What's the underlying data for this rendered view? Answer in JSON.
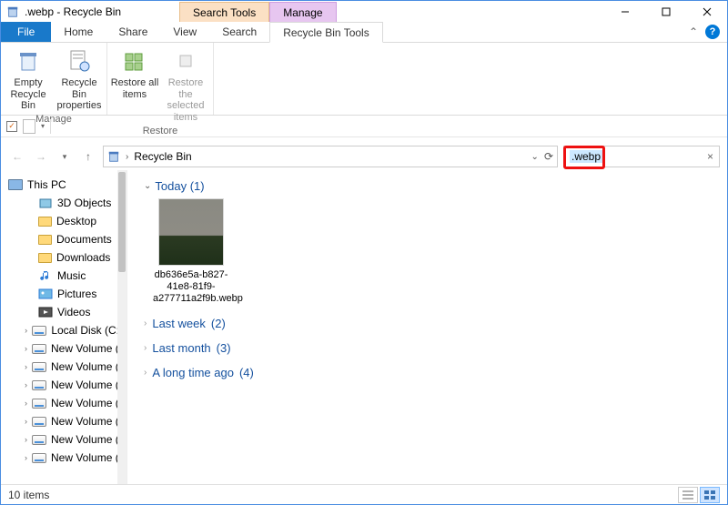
{
  "window": {
    "title": ".webp - Recycle Bin"
  },
  "context_tabs": [
    {
      "group": "Search Tools"
    },
    {
      "group": "Manage"
    }
  ],
  "ribbon_tabs": {
    "file": "File",
    "home": "Home",
    "share": "Share",
    "view": "View",
    "search": "Search",
    "manage_sub": "Recycle Bin Tools"
  },
  "ribbon": {
    "manage": {
      "empty": "Empty Recycle Bin",
      "props": "Recycle Bin properties",
      "group_label": "Manage"
    },
    "restore": {
      "all": "Restore all items",
      "selected": "Restore the selected items",
      "group_label": "Restore"
    }
  },
  "breadcrumb": {
    "root_icon": "recycle-bin",
    "path": "Recycle Bin"
  },
  "search": {
    "term": ".webp"
  },
  "sidebar": {
    "root": "This PC",
    "items": [
      {
        "label": "3D Objects",
        "type": "folder3d"
      },
      {
        "label": "Desktop",
        "type": "folder"
      },
      {
        "label": "Documents",
        "type": "folder"
      },
      {
        "label": "Downloads",
        "type": "folder"
      },
      {
        "label": "Music",
        "type": "music"
      },
      {
        "label": "Pictures",
        "type": "pictures"
      },
      {
        "label": "Videos",
        "type": "videos"
      },
      {
        "label": "Local Disk (C:)",
        "type": "drive"
      },
      {
        "label": "New Volume (D:)",
        "type": "drive"
      },
      {
        "label": "New Volume (E:)",
        "type": "drive"
      },
      {
        "label": "New Volume (F:)",
        "type": "drive"
      },
      {
        "label": "New Volume (G:)",
        "type": "drive"
      },
      {
        "label": "New Volume (H:)",
        "type": "drive"
      },
      {
        "label": "New Volume (I:)",
        "type": "drive"
      },
      {
        "label": "New Volume (J:)",
        "type": "drive"
      }
    ]
  },
  "content": {
    "groups": [
      {
        "label": "Today",
        "count": "(1)",
        "expanded": true,
        "files": [
          {
            "name": "db636e5a-b827-41e8-81f9-a277711a2f9b.webp"
          }
        ]
      },
      {
        "label": "Last week",
        "count": "(2)",
        "expanded": false
      },
      {
        "label": "Last month",
        "count": "(3)",
        "expanded": false
      },
      {
        "label": "A long time ago",
        "count": "(4)",
        "expanded": false
      }
    ]
  },
  "status": {
    "text": "10 items"
  }
}
